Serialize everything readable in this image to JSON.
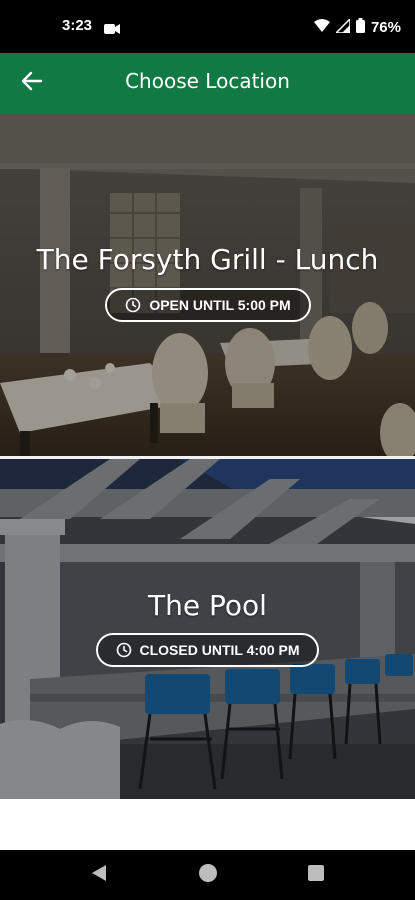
{
  "status_bar": {
    "time": "3:23",
    "battery": "76%",
    "icons": [
      "video-camera-icon",
      "wifi-icon",
      "signal-icon",
      "battery-icon"
    ]
  },
  "app_bar": {
    "title": "Choose Location",
    "back_icon": "arrow-left-icon",
    "color": "#117a44"
  },
  "locations": [
    {
      "name": "The Forsyth Grill - Lunch",
      "status": "OPEN UNTIL 5:00 PM",
      "status_icon": "clock-icon"
    },
    {
      "name": "The Pool",
      "status": "CLOSED UNTIL 4:00 PM",
      "status_icon": "clock-icon"
    }
  ],
  "nav_bar": {
    "buttons": [
      "back-triangle-icon",
      "home-circle-icon",
      "recents-square-icon"
    ]
  }
}
